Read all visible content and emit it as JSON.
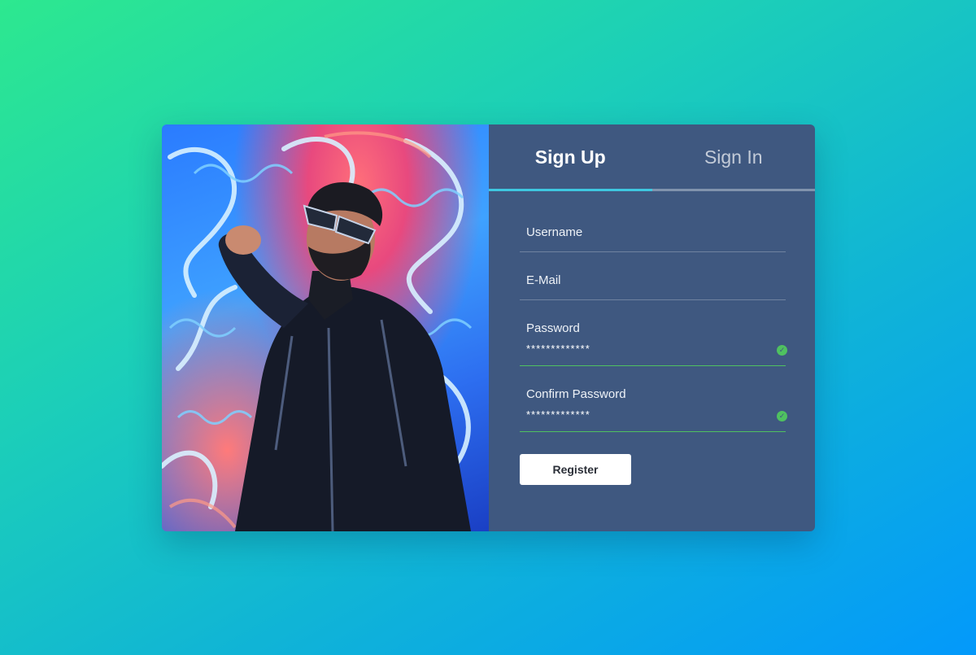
{
  "tabs": {
    "sign_up": "Sign Up",
    "sign_in": "Sign In"
  },
  "form": {
    "username_label": "Username",
    "email_label": "E-Mail",
    "password_label": "Password",
    "password_value": "*************",
    "confirm_password_label": "Confirm Password",
    "confirm_password_value": "*************"
  },
  "register_label": "Register",
  "icons": {
    "password_status": "check-circle-icon",
    "confirm_password_status": "check-circle-icon"
  },
  "colors": {
    "panel_background": "#3f5880",
    "active_tab_indicator": "#3ec7e0",
    "valid_green": "#4fc160",
    "button_background": "#ffffff"
  }
}
